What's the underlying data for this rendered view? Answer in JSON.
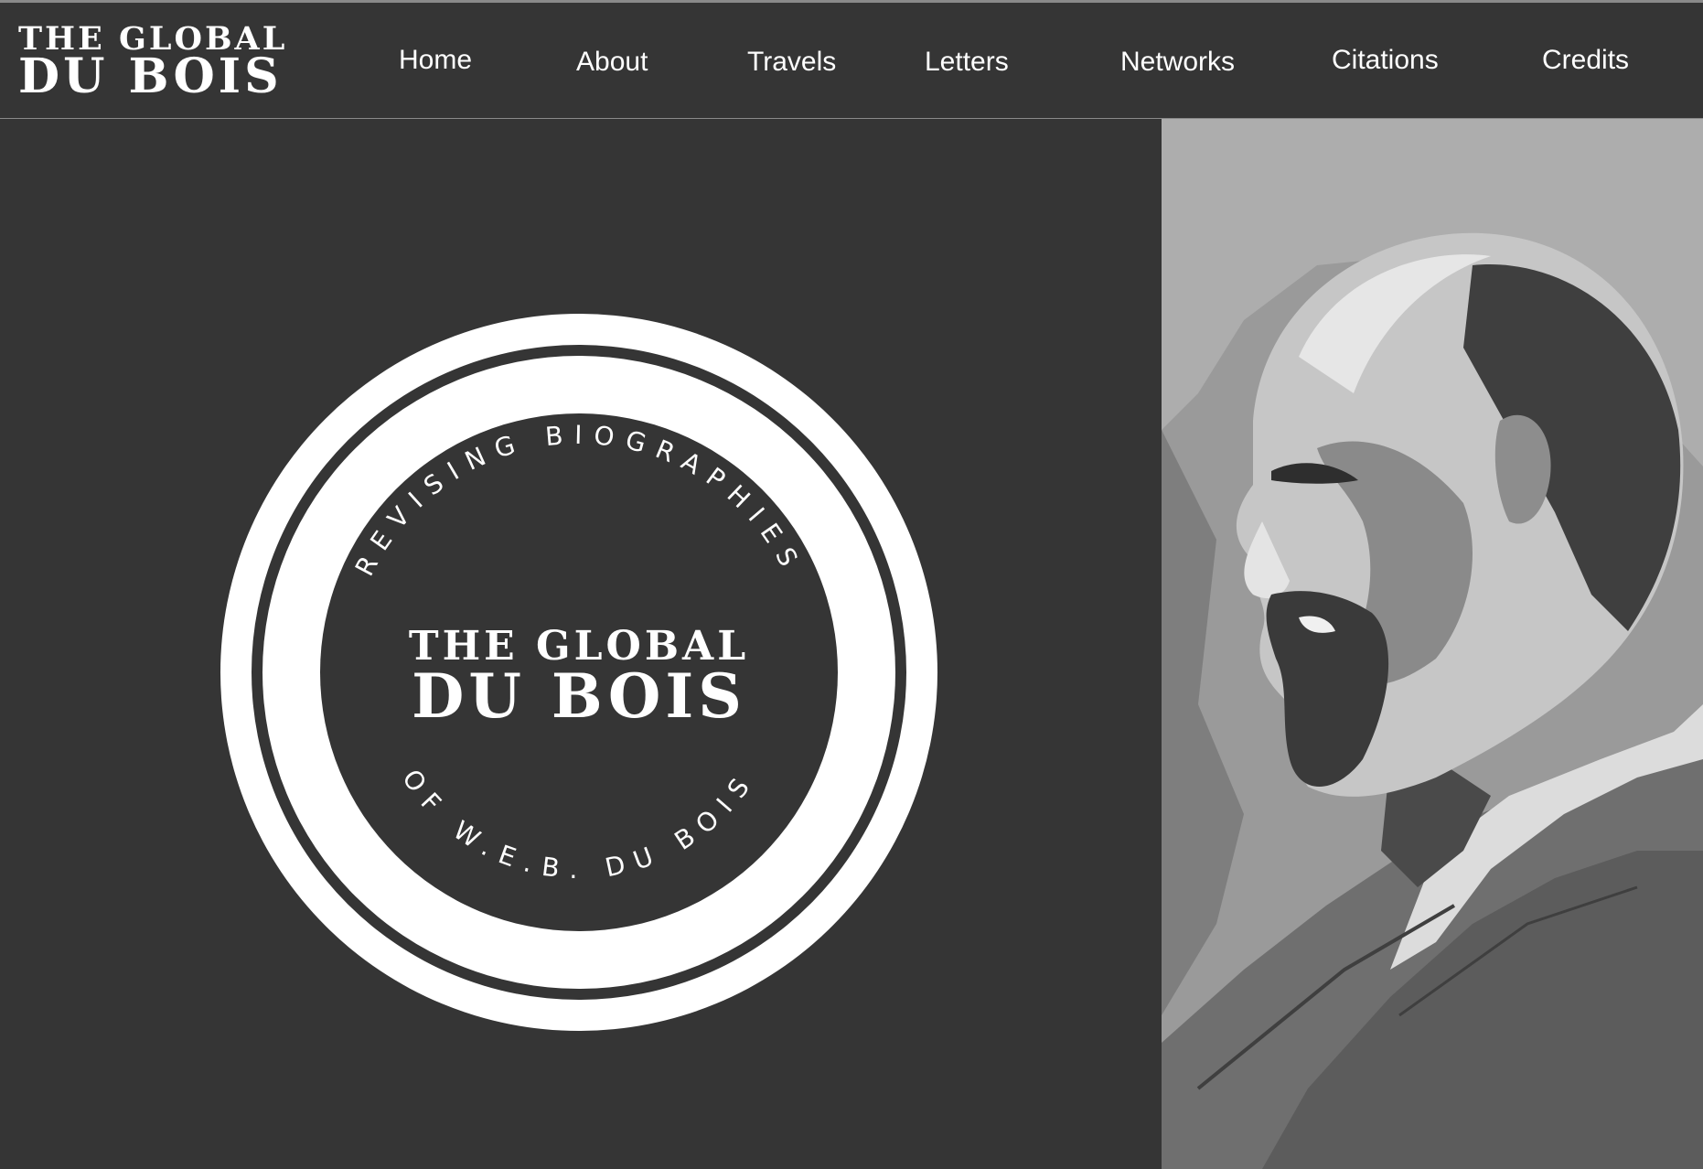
{
  "brand": {
    "title_line1": "THE GLOBAL",
    "title_line2": "DU BOIS"
  },
  "nav": {
    "items": [
      {
        "label": "Home"
      },
      {
        "label": "About"
      },
      {
        "label": "Travels"
      },
      {
        "label": "Letters"
      },
      {
        "label": "Networks"
      },
      {
        "label": "Citations"
      },
      {
        "label": "Credits"
      }
    ]
  },
  "hero": {
    "seal": {
      "top_arc_text": "REVISING BIOGRAPHIES",
      "title_line1": "THE GLOBAL",
      "title_line2": "DU BOIS",
      "bottom_arc_text": "OF W.E.B. DU BOIS"
    },
    "portrait": "portrait-illustration"
  },
  "colors": {
    "background": "#353535",
    "text": "#ffffff",
    "divider": "#8a8a8a"
  }
}
